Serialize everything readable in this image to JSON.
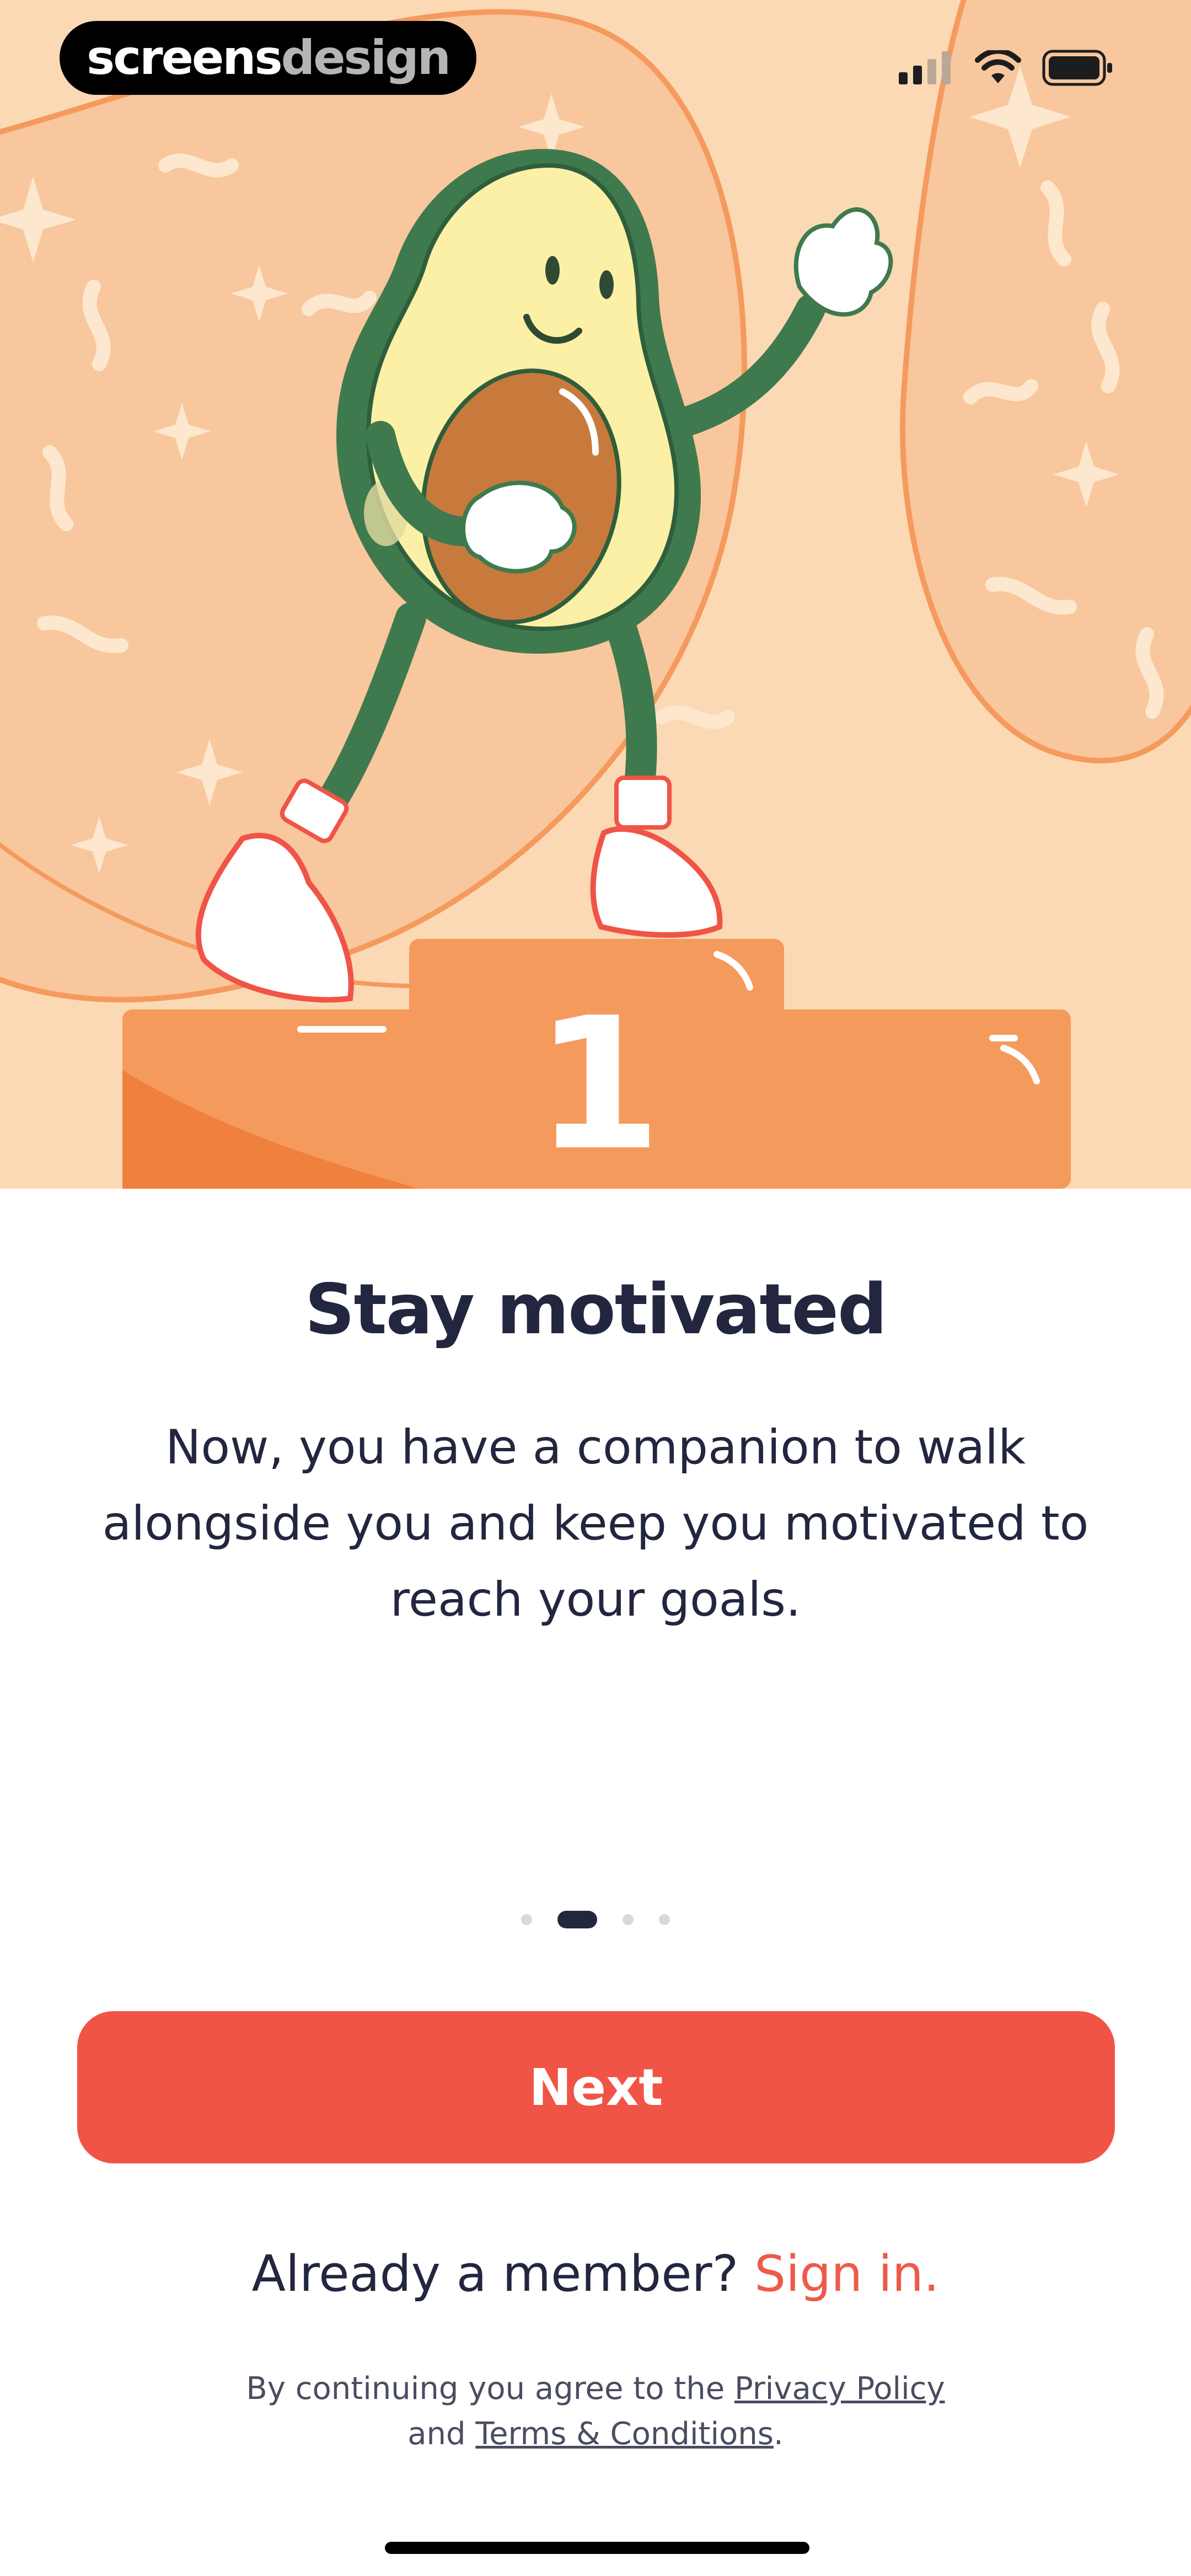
{
  "app": {
    "brand_part1": "screens",
    "brand_part2": "design"
  },
  "status_bar": {
    "signal_icon": "cellular-signal-icon",
    "wifi_icon": "wifi-icon",
    "battery_icon": "battery-icon"
  },
  "hero": {
    "illustration": "avatar-mascot-on-podium",
    "podium_number": "1",
    "colors": {
      "background": "#fbd9b5",
      "podium": "#f59a5d",
      "avocado_skin": "#3f7a4e",
      "avocado_flesh": "#fbf0a6",
      "pit": "#c87a3c"
    }
  },
  "onboarding": {
    "title": "Stay motivated",
    "description": "Now, you have a companion to walk alongside you and keep you motivated to reach your goals.",
    "pager": {
      "total": 4,
      "current": 2
    }
  },
  "actions": {
    "next_label": "Next",
    "member_prompt": "Already a member?",
    "signin_label": "Sign in."
  },
  "legal": {
    "prefix": "By continuing you agree to the",
    "privacy_label": "Privacy Policy",
    "and": "and",
    "terms_label": "Terms & Conditions",
    "suffix": "."
  },
  "theme": {
    "accent": "#f05446",
    "text_dark": "#22263f"
  }
}
